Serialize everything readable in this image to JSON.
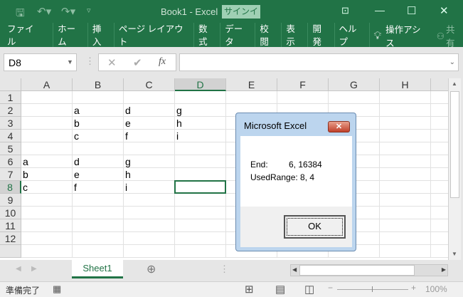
{
  "title": {
    "text": "Book1  -  Excel",
    "signin": "サインイン"
  },
  "ribbon": {
    "tabs": [
      "ファイル",
      "ホーム",
      "挿入",
      "ページ レイアウト",
      "数式",
      "データ",
      "校閲",
      "表示",
      "開発",
      "ヘルプ"
    ],
    "tell_me": "操作アシス",
    "share": "共有"
  },
  "formula": {
    "name_box": "D8",
    "fx": "fx",
    "value": ""
  },
  "columns": [
    "A",
    "B",
    "C",
    "D",
    "E",
    "F",
    "G",
    "H"
  ],
  "rows": [
    "1",
    "2",
    "3",
    "4",
    "5",
    "6",
    "7",
    "8",
    "9",
    "10",
    "11",
    "12"
  ],
  "cells": {
    "B2": "a",
    "C2": "d",
    "D2": "g",
    "B3": "b",
    "C3": "e",
    "D3": "h",
    "B4": "c",
    "C4": "f",
    "D4": "i",
    "A6": "a",
    "B6": "d",
    "C6": "g",
    "A7": "b",
    "B7": "e",
    "C7": "h",
    "A8": "c",
    "B8": "f",
    "C8": "i"
  },
  "selected_cell": "D8",
  "dialog": {
    "title": "Microsoft Excel",
    "line1_label": "End:",
    "line1_value": "6, 16384",
    "line2": "UsedRange: 8, 4",
    "ok": "OK"
  },
  "sheets": [
    "Sheet1"
  ],
  "status": {
    "text": "準備完了",
    "zoom": "100%"
  },
  "colors": {
    "accent": "#217346"
  }
}
